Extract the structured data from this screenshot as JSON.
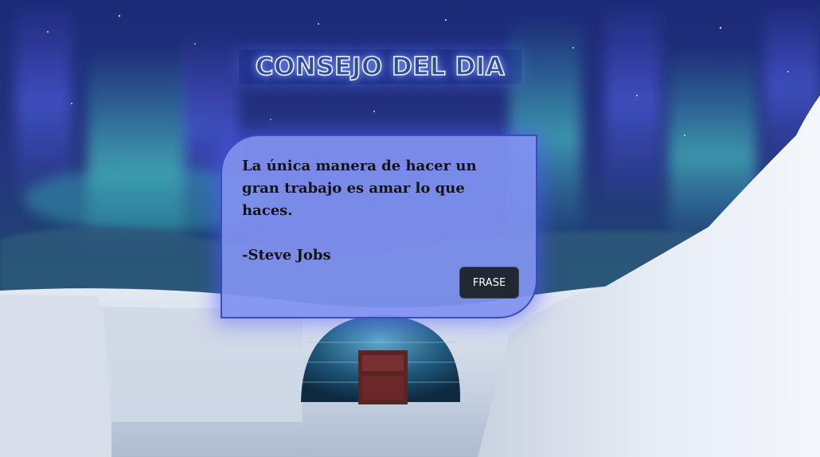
{
  "page": {
    "title": "CONSEJO DEL DIA"
  },
  "quote": {
    "text": "La única manera de hacer un gran trabajo es amar lo que haces.",
    "author": "-Steve Jobs",
    "button_label": "FRASE"
  },
  "colors": {
    "card_background": "#8091f0",
    "card_border": "#3a4cb8",
    "button_background": "#222833",
    "title_fill": "#2f4a9e",
    "title_outline": "#eef2ff"
  },
  "background": {
    "scene": "aurora-night-sky-igloo-snow"
  }
}
